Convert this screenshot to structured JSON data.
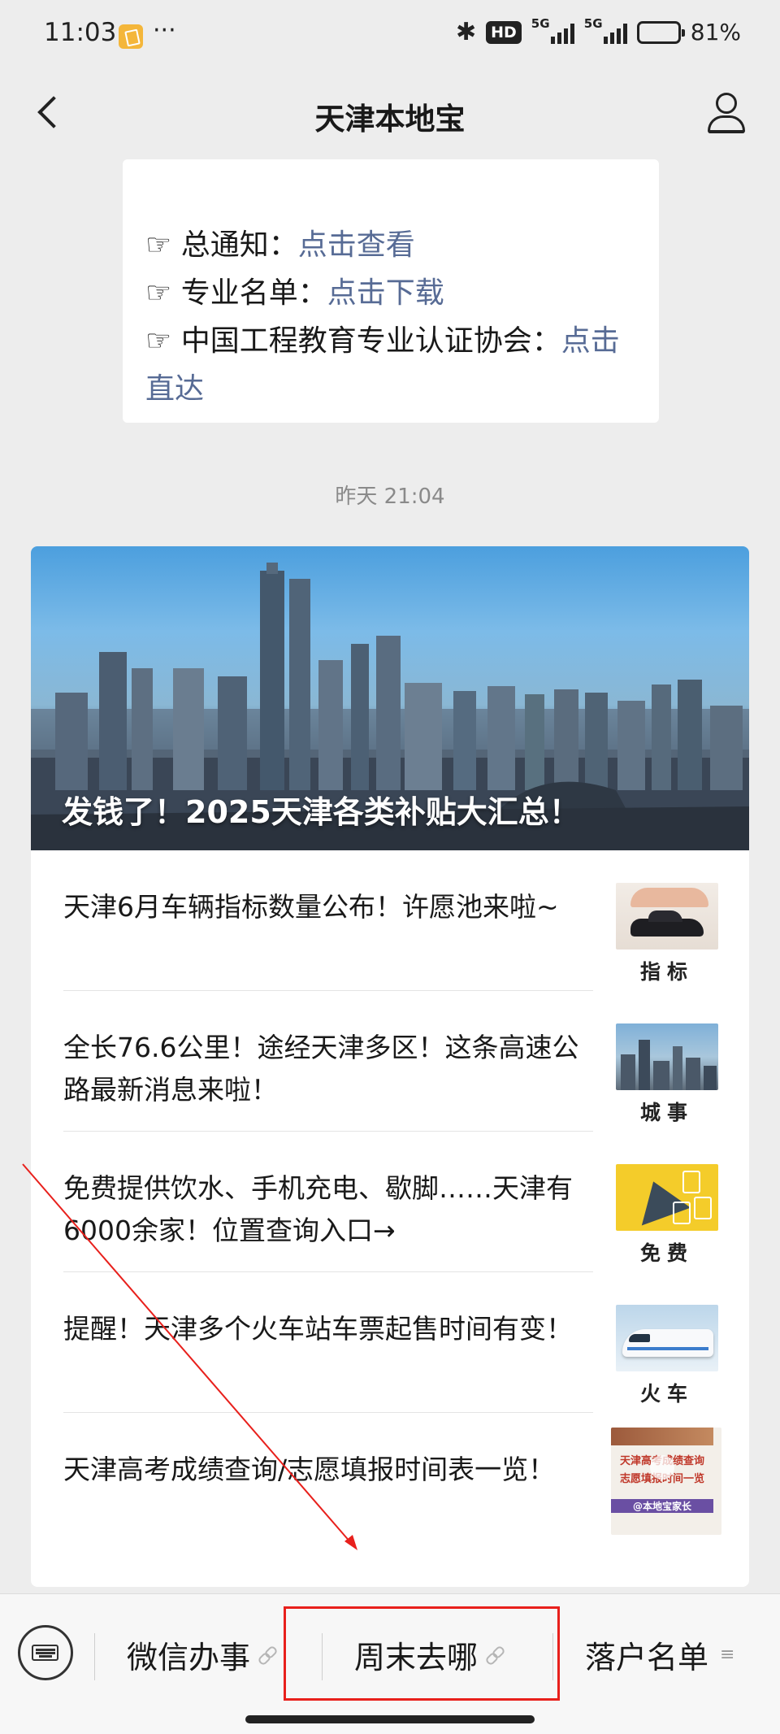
{
  "status_bar": {
    "time": "11:03",
    "more": "···",
    "hd_label": "HD",
    "network_1": "5G",
    "network_2": "5G",
    "battery_text": "81%",
    "battery_level": 0.81
  },
  "header": {
    "title": "天津本地宝"
  },
  "notice": {
    "items": [
      {
        "prefix": "☞ 总通知：",
        "link": "点击查看"
      },
      {
        "prefix": "☞ 专业名单：",
        "link": "点击下载"
      },
      {
        "prefix": "☞ 中国工程教育专业认证协会：",
        "link": "点击直达"
      }
    ]
  },
  "timestamp": "昨天 21:04",
  "article_card": {
    "cover_title": "发钱了！2025天津各类补贴大汇总！",
    "items": [
      {
        "title": "天津6月车辆指标数量公布！许愿池来啦~",
        "thumb_label": "指标"
      },
      {
        "title": "全长76.6公里！途经天津多区！这条高速公路最新消息来啦！",
        "thumb_label": "城事"
      },
      {
        "title": "免费提供饮水、手机充电、歇脚……天津有6000余家！位置查询入口→",
        "thumb_label": "免费"
      },
      {
        "title": "提醒！天津多个火车站车票起售时间有变！",
        "thumb_label": "火车"
      },
      {
        "title": "天津高考成绩查询/志愿填报时间表一览！",
        "thumb_label": "",
        "thumb_text_1": "天津高考成绩查询",
        "thumb_text_2": "志愿填报时间一览",
        "thumb_text_3": "@本地宝家长"
      }
    ]
  },
  "bottom_menu": {
    "items": [
      "微信办事",
      "周末去哪",
      "落户名单"
    ],
    "list_mark": "≡"
  },
  "colors": {
    "link": "#576b95",
    "annotation": "#e8201c"
  }
}
